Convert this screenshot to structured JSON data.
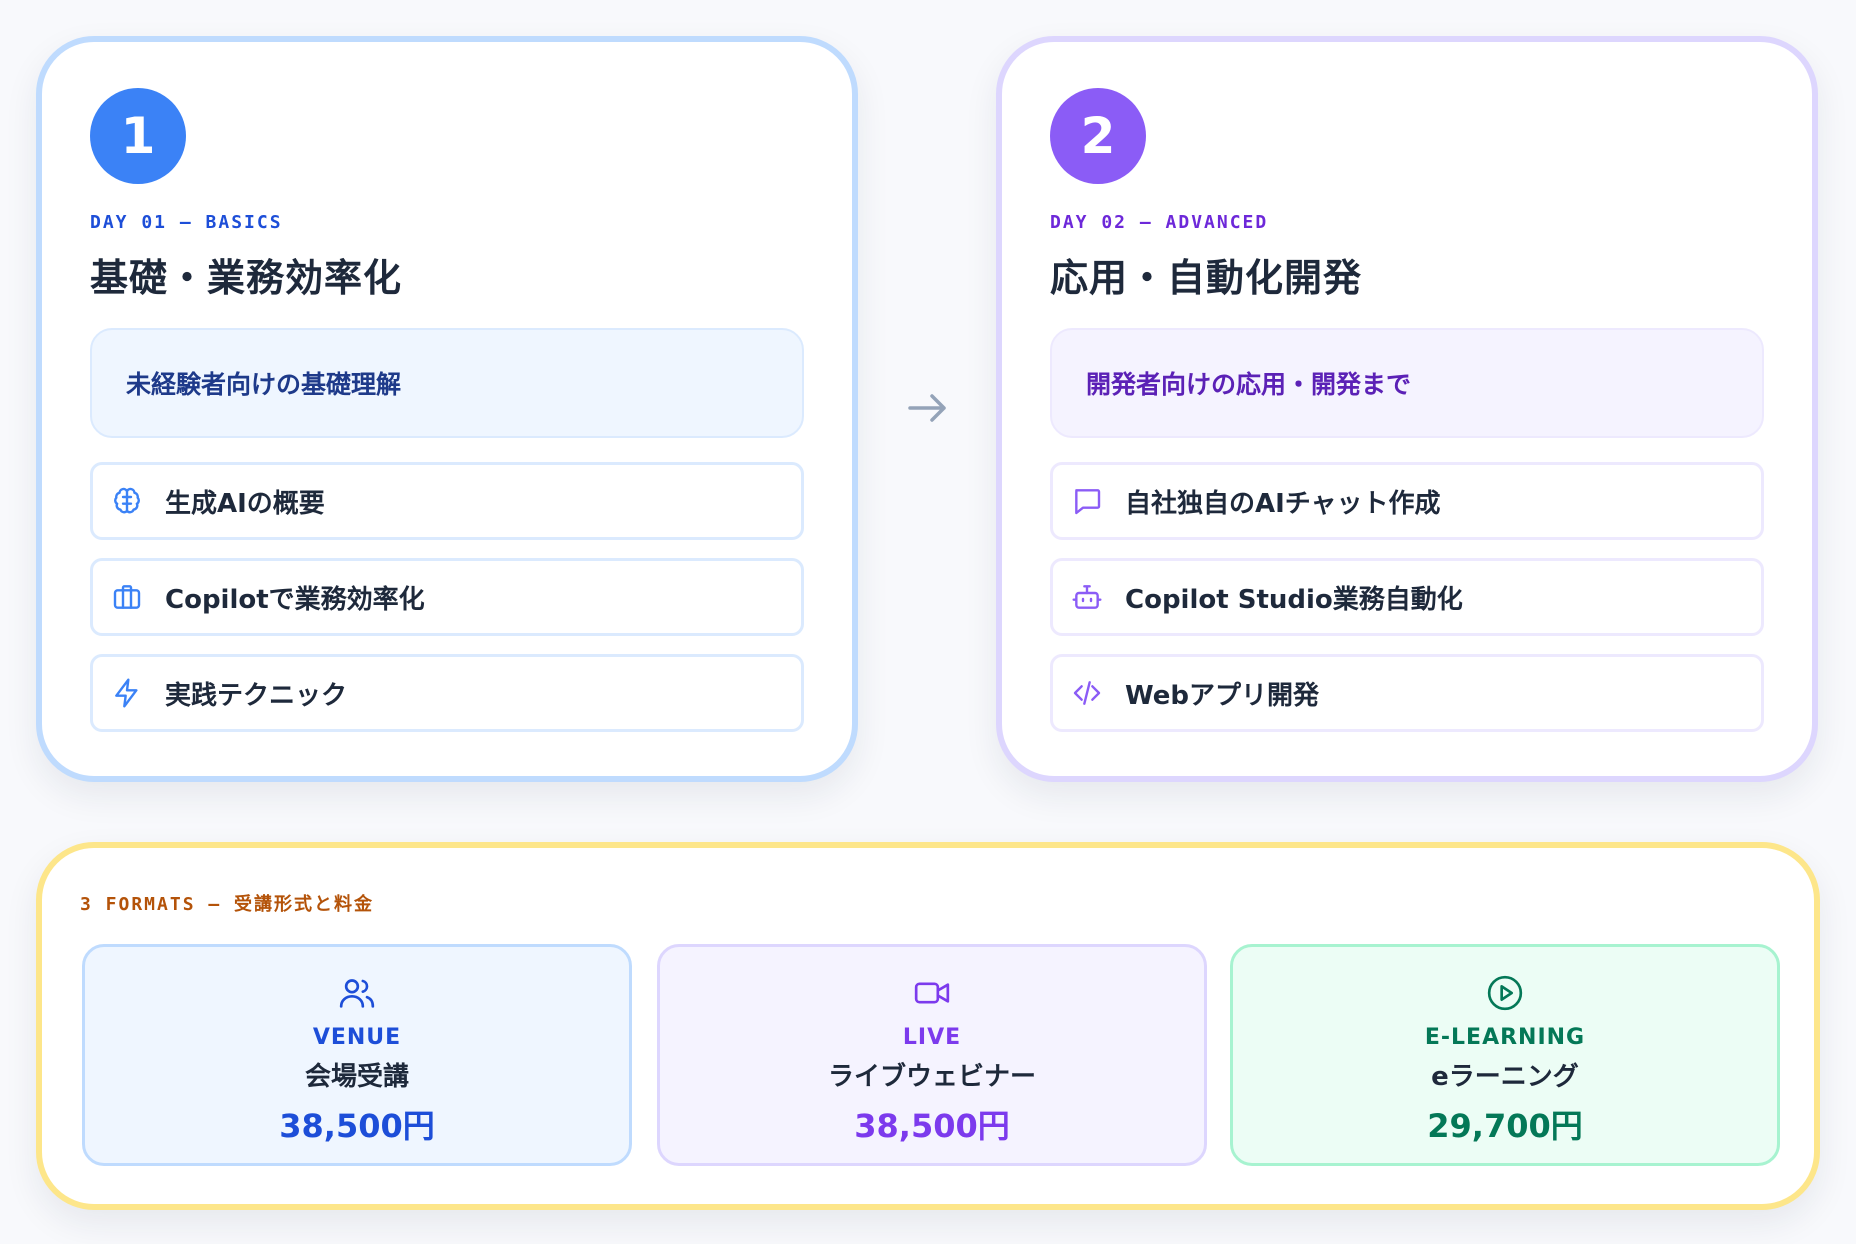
{
  "day1": {
    "badge": "1",
    "eyebrow": "DAY 01 — BASICS",
    "title": "基礎・業務効率化",
    "audience": "未経験者向けの基礎理解",
    "topics": [
      {
        "label": "生成AIの概要",
        "icon": "brain-icon"
      },
      {
        "label": "Copilotで業務効率化",
        "icon": "briefcase-icon"
      },
      {
        "label": "実践テクニック",
        "icon": "lightning-icon"
      }
    ]
  },
  "day2": {
    "badge": "2",
    "eyebrow": "DAY 02 — ADVANCED",
    "title": "応用・自動化開発",
    "audience": "開発者向けの応用・開発まで",
    "topics": [
      {
        "label": "自社独自のAIチャット作成",
        "icon": "chat-icon"
      },
      {
        "label": "Copilot Studio業務自動化",
        "icon": "robot-icon"
      },
      {
        "label": "Webアプリ開発",
        "icon": "code-icon"
      }
    ]
  },
  "formats": {
    "heading": "3 FORMATS — 受講形式と料金",
    "items": [
      {
        "code": "VENUE",
        "name": "会場受講",
        "price": "38,500円",
        "icon": "users-icon"
      },
      {
        "code": "LIVE",
        "name": "ライブウェビナー",
        "price": "38,500円",
        "icon": "video-icon"
      },
      {
        "code": "E-LEARNING",
        "name": "eラーニング",
        "price": "29,700円",
        "icon": "play-circle-icon"
      }
    ]
  },
  "colors": {
    "blue": "#3b82f6",
    "purple": "#8b5cf6",
    "amber": "#fde68a",
    "green": "#047857"
  }
}
